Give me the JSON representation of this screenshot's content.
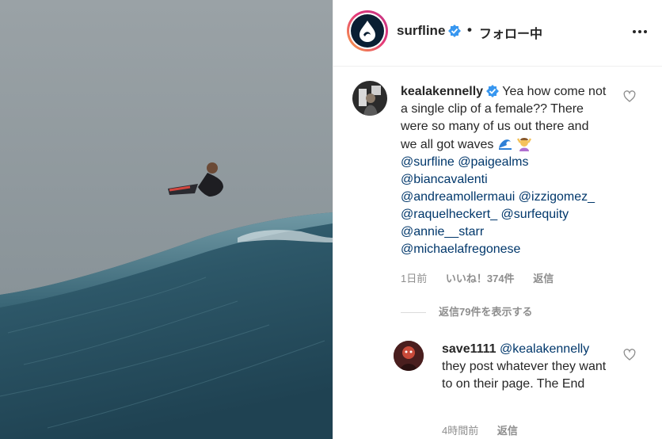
{
  "post": {
    "account": "surfline",
    "separator": "•",
    "follow_status": "フォロー中",
    "image_alt": "surfer airborne above a large wave"
  },
  "comment": {
    "username": "kealakennelly",
    "text": "Yea how come not a single clip of a female?? There were so many of us out there and we all got waves",
    "emojis": [
      "wave-emoji",
      "woman-raising-hands-emoji"
    ],
    "mentions": [
      "@surfline",
      "@paigealms",
      "@biancavalenti",
      "@andreamollermaui",
      "@izzigomez_",
      "@raquelheckert_",
      "@surfequity",
      "@annie__starr",
      "@michaelafregonese"
    ],
    "time": "1日前",
    "likes": "いいね！374件",
    "reply_label": "返信",
    "view_replies": "返信79件を表示する"
  },
  "reply": {
    "username": "save1111",
    "mention": "@kealakennelly",
    "text": "they post whatever they want to on their page. The End",
    "time": "4時間前",
    "reply_label": "返信"
  },
  "colors": {
    "text": "#262626",
    "muted": "#8e8e8e",
    "mention": "#00376b",
    "verified": "#3897f0",
    "ocean": "#2f5a6b",
    "sky": "#8f999e"
  },
  "icons": {
    "verified": "verified-badge-icon",
    "heart": "heart-outline-icon",
    "more": "more-options-icon"
  }
}
